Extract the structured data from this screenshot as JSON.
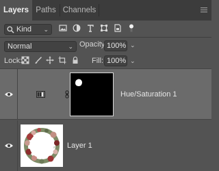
{
  "tabs": [
    {
      "label": "Layers",
      "active": true
    },
    {
      "label": "Paths",
      "active": false
    },
    {
      "label": "Channels",
      "active": false
    }
  ],
  "filter": {
    "kind_label": "Kind",
    "icons": [
      "pixel-filter-icon",
      "adjustment-filter-icon",
      "type-filter-icon",
      "shape-filter-icon",
      "smart-object-filter-icon",
      "filter-toggle-icon"
    ]
  },
  "blend": {
    "mode": "Normal",
    "opacity_label": "Opacity:",
    "opacity_value": "100%"
  },
  "lock": {
    "label": "Lock:",
    "icons": [
      "lock-transparent-pixels-icon",
      "lock-image-pixels-icon",
      "lock-position-icon",
      "lock-artboard-icon",
      "lock-all-icon"
    ],
    "fill_label": "Fill:",
    "fill_value": "100%"
  },
  "layers": [
    {
      "name": "Hue/Saturation 1",
      "selected": true,
      "visible": true
    },
    {
      "name": "Layer 1",
      "selected": false,
      "visible": true
    }
  ],
  "colors": {
    "panel_bg": "#535353",
    "tab_bar_bg": "#3c3c3c",
    "selected_row": "#6b6b6b",
    "input_bg": "#424242"
  }
}
